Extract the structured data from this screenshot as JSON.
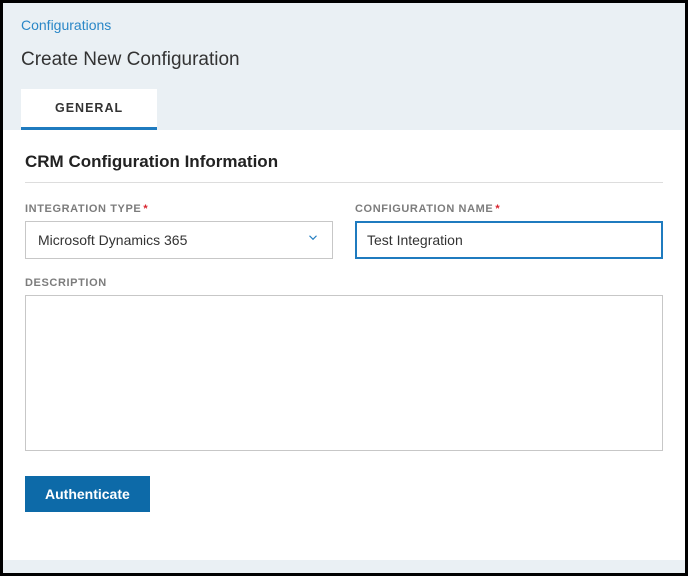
{
  "breadcrumb": {
    "configurations": "Configurations"
  },
  "page": {
    "title": "Create New Configuration"
  },
  "tabs": {
    "general": "GENERAL"
  },
  "section": {
    "title": "CRM Configuration Information"
  },
  "fields": {
    "integration_type": {
      "label": "INTEGRATION TYPE",
      "value": "Microsoft Dynamics 365"
    },
    "configuration_name": {
      "label": "CONFIGURATION NAME",
      "value": "Test Integration"
    },
    "description": {
      "label": "DESCRIPTION",
      "value": ""
    }
  },
  "buttons": {
    "authenticate": "Authenticate"
  },
  "required_marker": "*"
}
